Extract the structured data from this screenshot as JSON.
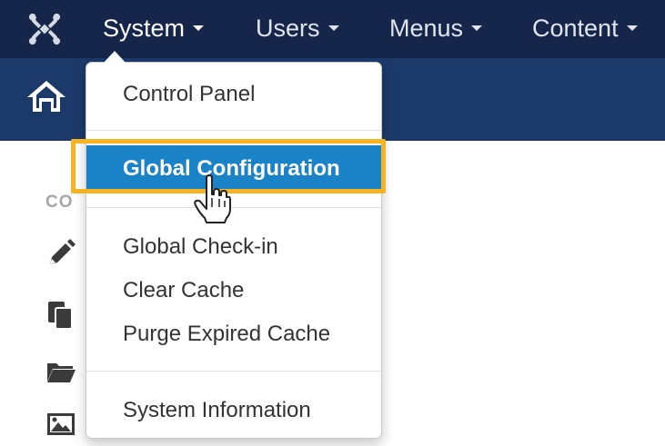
{
  "topbar": {
    "logo": "joomla-logo",
    "menus": [
      {
        "label": "System"
      },
      {
        "label": "Users"
      },
      {
        "label": "Menus"
      },
      {
        "label": "Content"
      }
    ]
  },
  "subbar": {
    "icon": "home-icon"
  },
  "sidebar": {
    "heading": "CO",
    "icons": [
      "pencil-icon",
      "copy-icon",
      "folder-icon",
      "image-icon"
    ]
  },
  "dropdown": {
    "items": [
      {
        "label": "Control Panel"
      },
      {
        "label": "Global Configuration"
      },
      {
        "label": "Global Check-in"
      },
      {
        "label": "Clear Cache"
      },
      {
        "label": "Purge Expired Cache"
      },
      {
        "label": "System Information"
      }
    ],
    "active_index": 1
  },
  "colors": {
    "topbar": "#16264b",
    "subbar": "#1b3a6a",
    "active": "#1a82c6",
    "highlight": "#f7b322"
  },
  "cursor": "hand-pointer-icon"
}
